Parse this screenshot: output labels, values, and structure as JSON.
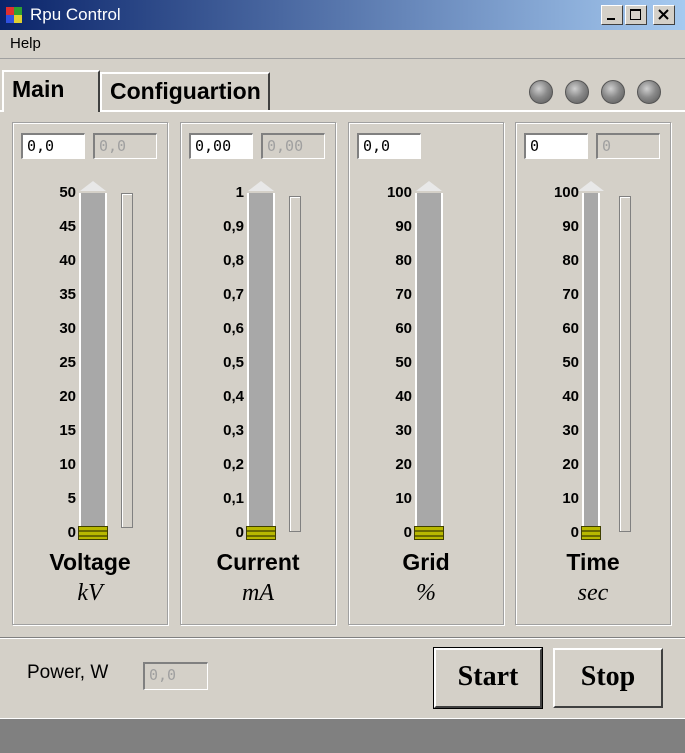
{
  "window": {
    "title": "Rpu Control"
  },
  "menu": {
    "help": "Help"
  },
  "tabs": [
    {
      "label": "Main",
      "active": true
    },
    {
      "label": "Configuartion",
      "active": false
    }
  ],
  "groups": [
    {
      "name": "Voltage",
      "unit": "kV",
      "input": "0,0",
      "readout": "0,0",
      "ticks": [
        "50",
        "45",
        "40",
        "35",
        "30",
        "25",
        "20",
        "15",
        "10",
        "5",
        "0"
      ]
    },
    {
      "name": "Current",
      "unit": "mA",
      "input": "0,00",
      "readout": "0,00",
      "ticks": [
        "1",
        "0,9",
        "0,8",
        "0,7",
        "0,6",
        "0,5",
        "0,4",
        "0,3",
        "0,2",
        "0,1",
        "0"
      ]
    },
    {
      "name": "Grid",
      "unit": "%",
      "input": "0,0",
      "readout": "",
      "ticks": [
        "100",
        "90",
        "80",
        "70",
        "60",
        "50",
        "40",
        "30",
        "20",
        "10",
        "0"
      ]
    },
    {
      "name": "Time",
      "unit": "sec",
      "input": "0",
      "readout": "0",
      "ticks": [
        "100",
        "90",
        "80",
        "70",
        "60",
        "50",
        "40",
        "30",
        "20",
        "10",
        "0"
      ]
    }
  ],
  "power": {
    "label": "Power, W",
    "value": "0,0"
  },
  "buttons": {
    "start": "Start",
    "stop": "Stop"
  },
  "colors": {
    "titlebar": "#0a246a",
    "face": "#d4d0c8",
    "thumb": "#b8b800"
  }
}
